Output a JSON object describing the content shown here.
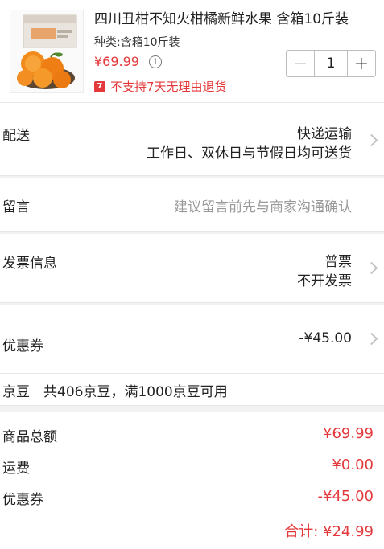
{
  "product": {
    "title": "四川丑柑不知火柑橘新鲜水果 含箱10斤装",
    "spec": "种类:含箱10斤装",
    "price": "¥69.99",
    "return_icon_text": "7",
    "return_notice": "不支持7天无理由退货",
    "quantity": "1",
    "minus_symbol": "−",
    "plus_symbol": "+",
    "info_icon_text": "i",
    "thumbnail_icon": "orange-fruit-box-image"
  },
  "delivery": {
    "label": "配送",
    "method": "快递运输",
    "schedule": "工作日、双休日与节假日均可送货"
  },
  "message": {
    "label": "留言",
    "placeholder": "建议留言前先与商家沟通确认"
  },
  "invoice": {
    "label": "发票信息",
    "type": "普票",
    "status": "不开发票"
  },
  "coupon": {
    "label": "优惠券",
    "value": "-¥45.00"
  },
  "jingdou": {
    "text": "京豆　共406京豆，满1000京豆可用"
  },
  "summary": {
    "items": [
      {
        "label": "商品总额",
        "value": "¥69.99"
      },
      {
        "label": "运费",
        "value": "¥0.00"
      },
      {
        "label": "优惠券",
        "value": "-¥45.00"
      }
    ],
    "total": "合计: ¥24.99"
  },
  "colors": {
    "accent_red": "#e4393c",
    "background": "#f2f2f2",
    "text": "#222222",
    "placeholder": "#999999"
  }
}
